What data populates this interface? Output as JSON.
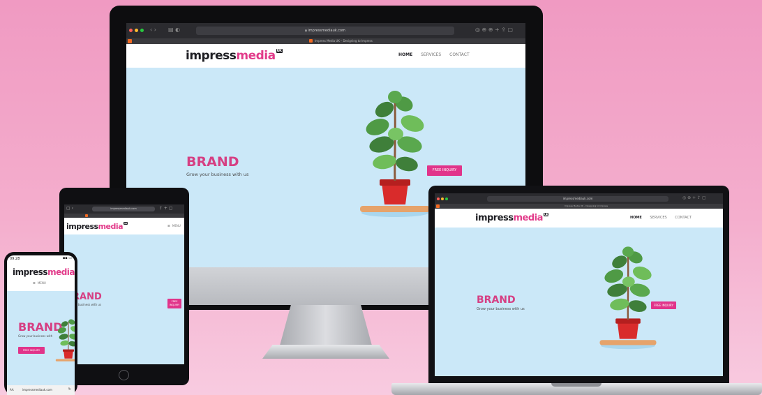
{
  "brand": {
    "logo_impress": "impress",
    "logo_media": "media",
    "logo_uk": "UK",
    "headline": "BRAND",
    "headline_cropped": "RAND",
    "tagline": "Grow your business with us",
    "tagline_cropped": "our business with us",
    "tagline_phone": "Grow your business with"
  },
  "nav": {
    "home": "HOME",
    "services": "SERVICES",
    "contact": "CONTACT",
    "menu": "MENU"
  },
  "cta": {
    "label": "FREE INQUIRY",
    "label_stacked_1": "FREE",
    "label_stacked_2": "INQUIRY"
  },
  "browser": {
    "url": "impressmediauk.com",
    "tab_title": "Impress Media UK – Designing to Impress"
  },
  "phone": {
    "time": "09:28",
    "url": "impressmediauk.com",
    "aa": "AA"
  },
  "colors": {
    "accent": "#e1348a",
    "hero_bg": "#cbe8f8",
    "page_bg": "#f4aecd"
  }
}
